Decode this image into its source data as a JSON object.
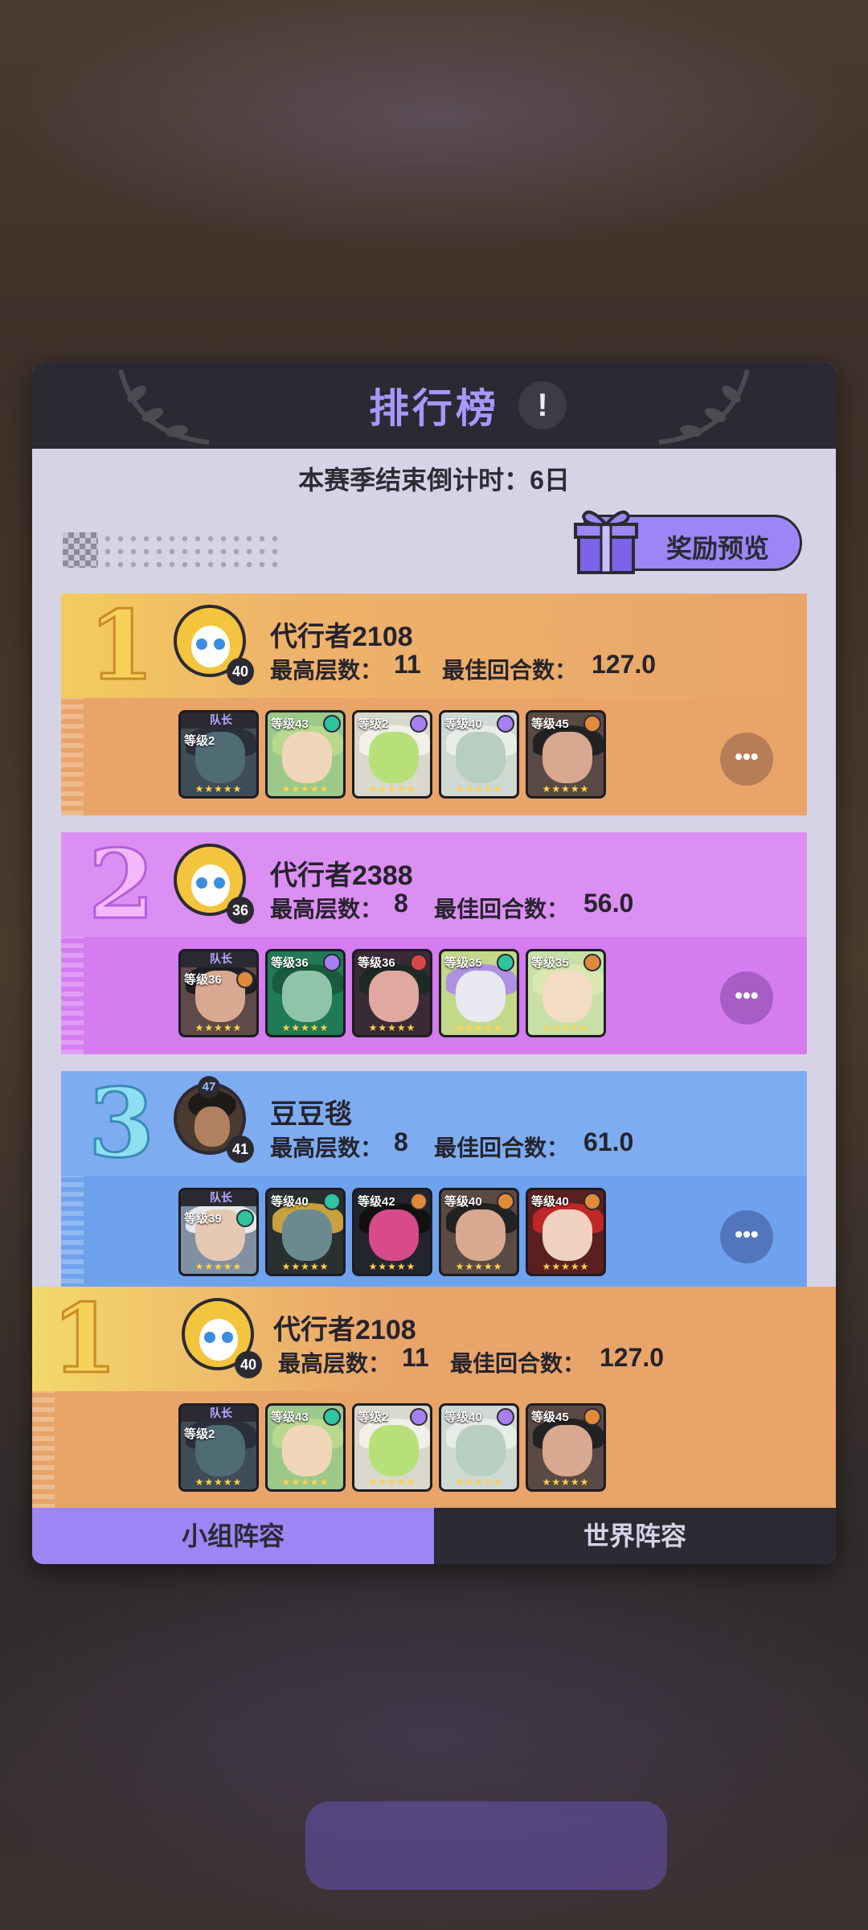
{
  "panel": {
    "title": "排行榜",
    "info_label": "!",
    "countdown": "本赛季结束倒计时：6日",
    "reward_label": "奖励预览"
  },
  "labels": {
    "max_floor": "最高层数：",
    "best_rounds": "最佳回合数：",
    "captain": "队长",
    "more": "•••"
  },
  "rankings": [
    {
      "rank": "1",
      "name": "代行者2108",
      "level": "40",
      "max_floor": "11",
      "best_rounds": "127.0",
      "heroes": [
        {
          "lv": "等级2",
          "captain": true
        },
        {
          "lv": "等级43"
        },
        {
          "lv": "等级2"
        },
        {
          "lv": "等级40"
        },
        {
          "lv": "等级45"
        }
      ]
    },
    {
      "rank": "2",
      "name": "代行者2388",
      "level": "36",
      "max_floor": "8",
      "best_rounds": "56.0",
      "heroes": [
        {
          "lv": "等级36",
          "captain": true
        },
        {
          "lv": "等级36"
        },
        {
          "lv": "等级36"
        },
        {
          "lv": "等级35"
        },
        {
          "lv": "等级35"
        }
      ]
    },
    {
      "rank": "3",
      "name": "豆豆毯",
      "level": "41",
      "extra_badge": "47",
      "max_floor": "8",
      "best_rounds": "61.0",
      "heroes": [
        {
          "lv": "等级39",
          "captain": true
        },
        {
          "lv": "等级40"
        },
        {
          "lv": "等级42"
        },
        {
          "lv": "等级40"
        },
        {
          "lv": "等级40"
        }
      ]
    }
  ],
  "my_rank": {
    "rank": "1",
    "name": "代行者2108",
    "level": "40",
    "max_floor": "11",
    "best_rounds": "127.0",
    "heroes": [
      {
        "lv": "等级2",
        "captain": true
      },
      {
        "lv": "等级43"
      },
      {
        "lv": "等级2"
      },
      {
        "lv": "等级40"
      },
      {
        "lv": "等级45"
      }
    ]
  },
  "tabs": {
    "group": "小组阵容",
    "world": "世界阵容"
  },
  "colors": {
    "rank1_top": "#f0c45f",
    "rank1_bottom": "#e9a46a",
    "rank2": "#d98cf0",
    "rank3": "#7aa9ef",
    "accent": "#9c86f5"
  }
}
